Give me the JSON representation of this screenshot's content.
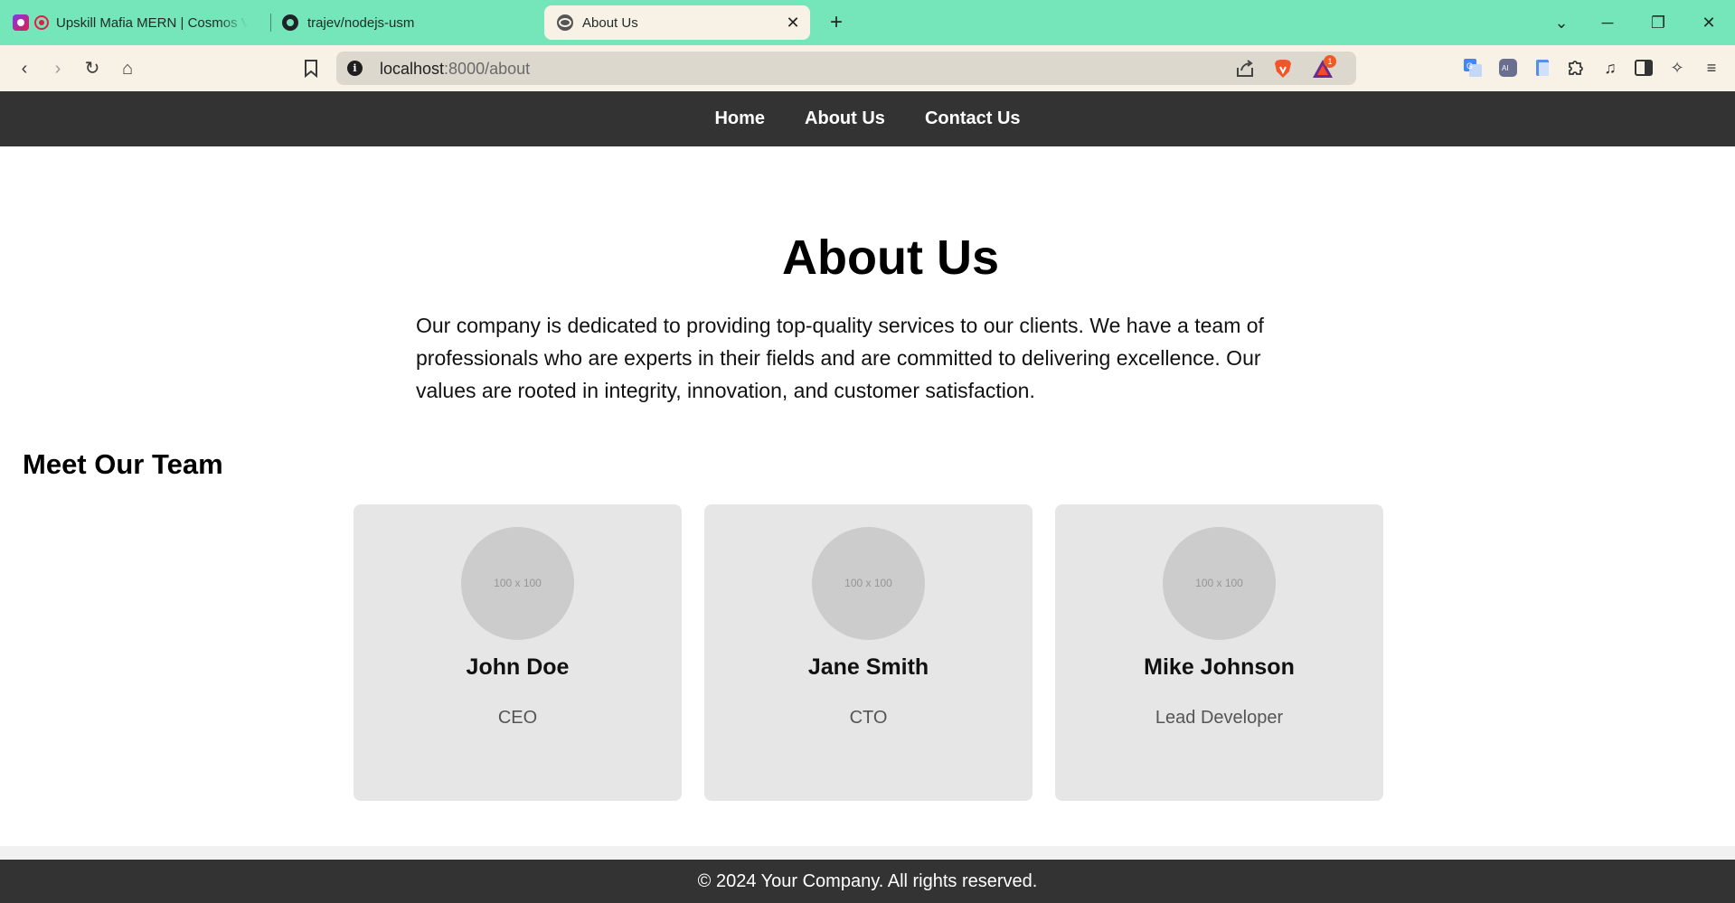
{
  "browser": {
    "tabs": [
      {
        "title": "Upskill Mafia MERN | Cosmos Vi",
        "icon": "cosmos-favicon"
      },
      {
        "title": "trajev/nodejs-usm",
        "icon": "github-favicon"
      },
      {
        "title": "About Us",
        "icon": "globe-favicon",
        "active": true
      }
    ],
    "url_host": "localhost",
    "url_path": ":8000/about",
    "bat_badge": "1"
  },
  "site": {
    "nav": [
      "Home",
      "About Us",
      "Contact Us"
    ],
    "about_title": "About Us",
    "about_text": "Our company is dedicated to providing top-quality services to our clients. We have a team of professionals who are experts in their fields and are committed to delivering excellence. Our values are rooted in integrity, innovation, and customer satisfaction.",
    "team_title": "Meet Our Team",
    "team": [
      {
        "name": "John Doe",
        "role": "CEO",
        "avatar": "100 x 100"
      },
      {
        "name": "Jane Smith",
        "role": "CTO",
        "avatar": "100 x 100"
      },
      {
        "name": "Mike Johnson",
        "role": "Lead Developer",
        "avatar": "100 x 100"
      }
    ],
    "footer": "© 2024 Your Company. All rights reserved."
  }
}
